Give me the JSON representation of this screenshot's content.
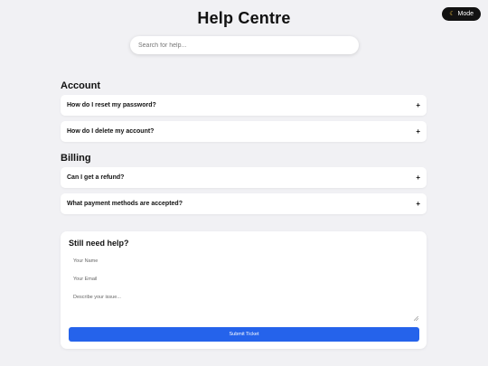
{
  "header": {
    "title": "Help Centre",
    "mode_toggle": {
      "icon": "moon-icon",
      "label": "Mode"
    }
  },
  "search": {
    "placeholder": "Search for help...",
    "value": ""
  },
  "sections": [
    {
      "title": "Account",
      "questions": [
        {
          "text": "How do I reset my password?",
          "toggle": "+"
        },
        {
          "text": "How do I delete my account?",
          "toggle": "+"
        }
      ]
    },
    {
      "title": "Billing",
      "questions": [
        {
          "text": "Can I get a refund?",
          "toggle": "+"
        },
        {
          "text": "What payment methods are accepted?",
          "toggle": "+"
        }
      ]
    }
  ],
  "ticket": {
    "title": "Still need help?",
    "name_placeholder": "Your Name",
    "email_placeholder": "Your Email",
    "issue_placeholder": "Describe your issue...",
    "submit_label": "Submit Ticket"
  },
  "colors": {
    "background": "#f1f1f4",
    "accent": "#2563eb",
    "toggle_bg": "#121212"
  }
}
